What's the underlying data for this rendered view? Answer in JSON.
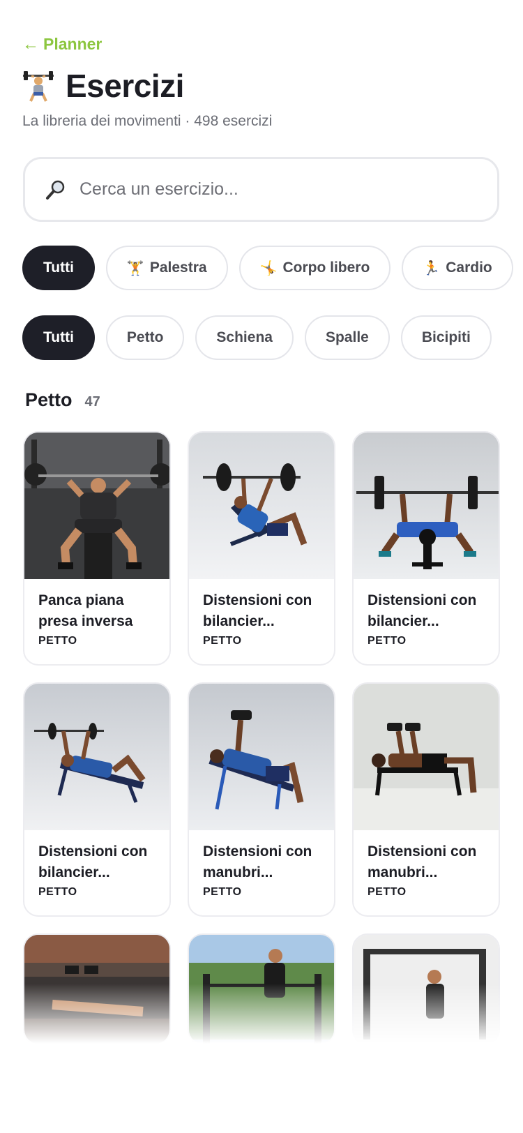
{
  "nav": {
    "back_label": "Planner"
  },
  "header": {
    "title": "Esercizi",
    "subtitle": "La libreria dei movimenti · 498 esercizi"
  },
  "search": {
    "placeholder": "Cerca un esercizio..."
  },
  "type_filters": [
    {
      "label": "Tutti",
      "active": true
    },
    {
      "label": "Palestra",
      "icon": "weightlifter-icon",
      "active": false
    },
    {
      "label": "Corpo libero",
      "icon": "cartwheel-icon",
      "active": false
    },
    {
      "label": "Cardio",
      "icon": "runner-icon",
      "active": false
    }
  ],
  "muscle_filters": [
    {
      "label": "Tutti",
      "active": true
    },
    {
      "label": "Petto",
      "active": false
    },
    {
      "label": "Schiena",
      "active": false
    },
    {
      "label": "Spalle",
      "active": false
    },
    {
      "label": "Bicipiti",
      "active": false
    }
  ],
  "section": {
    "title": "Petto",
    "count": "47"
  },
  "exercises": [
    {
      "name": "Panca piana presa inversa",
      "category": "PETTO",
      "image": "gym-bench-press-photo"
    },
    {
      "name": "Distensioni con bilancier...",
      "category": "PETTO",
      "image": "incline-barbell-press-photo"
    },
    {
      "name": "Distensioni con bilancier...",
      "category": "PETTO",
      "image": "flat-barbell-press-photo"
    },
    {
      "name": "Distensioni con bilancier...",
      "category": "PETTO",
      "image": "decline-barbell-press-photo"
    },
    {
      "name": "Distensioni con manubri...",
      "category": "PETTO",
      "image": "incline-dumbbell-press-photo"
    },
    {
      "name": "Distensioni con manubri...",
      "category": "PETTO",
      "image": "flat-dumbbell-press-photo"
    },
    {
      "name": "",
      "category": "",
      "image": "gym-dumbbell-press-photo"
    },
    {
      "name": "",
      "category": "",
      "image": "outdoor-dips-photo"
    },
    {
      "name": "",
      "category": "",
      "image": "cable-machine-photo"
    }
  ],
  "colors": {
    "accent": "#8cc63f",
    "active_chip": "#1e1f28",
    "text": "#1c1d24",
    "muted": "#6b6d75"
  }
}
